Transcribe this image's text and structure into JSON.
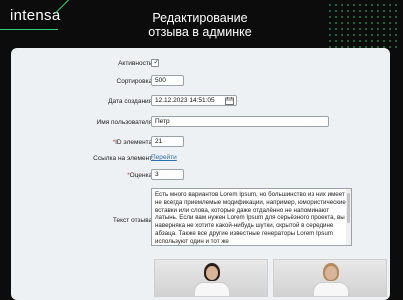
{
  "header": {
    "logo": "intensa",
    "title_line1": "Редактирование",
    "title_line2": "отзыва в админке"
  },
  "form": {
    "active_label": "Активность:",
    "active_checked": true,
    "sort_label": "Сортировка:",
    "sort_value": "500",
    "created_label": "Дата создания:",
    "created_value": "12.12.2023 14:51:05",
    "username_label": "Имя пользователя:",
    "username_value": "Петр",
    "element_id_label": "ID элемента:",
    "element_id_value": "21",
    "element_link_label": "Ссылка на элемент:",
    "element_link_text": "Перейти",
    "rating_label": "Оценка:",
    "rating_value": "3",
    "review_label": "Текст отзыва:",
    "review_text": "Есть много вариантов Lorem Ipsum, но большинство из них имеет не всегда приемлемые модификации, например, юмористические вставки или слова, которые даже отдалённо не напоминают латынь. Если вам нужен Lorem Ipsum для серьёзного проекта, вы наверняка не хотите какой-нибудь шутки, скрытой в середине абзаца. Также все другие известные генераторы Lorem Ipsum используют один и тот же",
    "required_mark": "*"
  },
  "icons": {
    "calendar": "calendar-icon",
    "checkmark": "check-icon"
  },
  "colors": {
    "accent": "#2fd27a",
    "background": "#0c0c0c",
    "panel": "#eef1f3",
    "link": "#2a6fb0"
  }
}
